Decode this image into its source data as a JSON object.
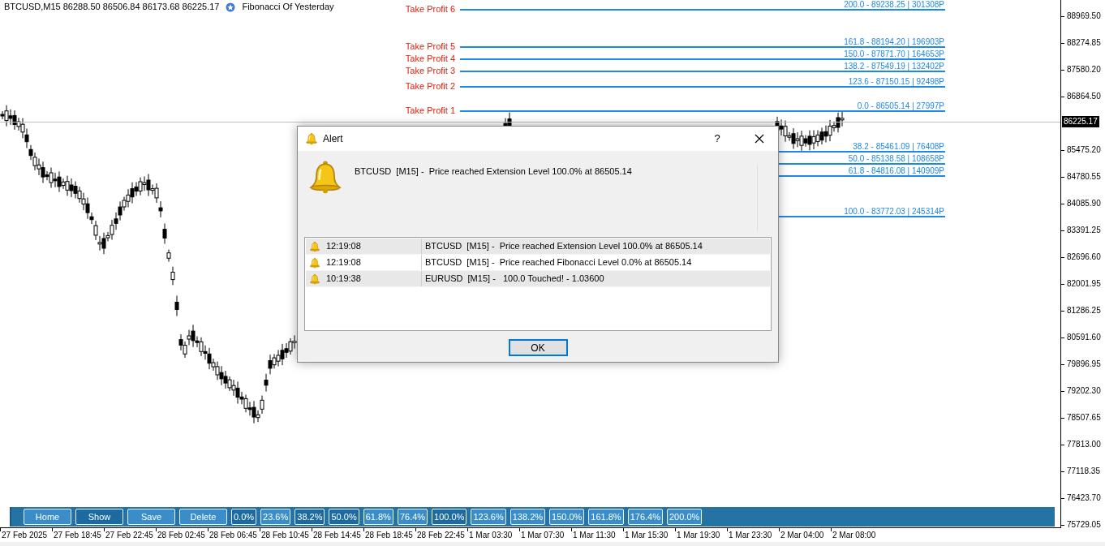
{
  "chart_header": {
    "symbol_info": "BTCUSD,M15  86288.50 86506.84 86173.68 86225.17",
    "indicator": "Fibonacci Of Yesterday"
  },
  "take_profit_labels": [
    "Take Profit 6",
    "Take Profit 5",
    "Take Profit 4",
    "Take Profit 3",
    "Take Profit 2",
    "Take Profit 1"
  ],
  "fib_levels": [
    {
      "label": "200.0 - 89238.25 | 301308P"
    },
    {
      "label": "161.8 - 88194.20 | 196903P"
    },
    {
      "label": "150.0 - 87871.70 | 164653P"
    },
    {
      "label": "138.2 - 87549.19 | 132402P"
    },
    {
      "label": "123.6 - 87150.15 | 92498P"
    },
    {
      "label": "0.0 - 86505.14 | 27997P"
    },
    {
      "label": "38.2 - 85461.09 | 76408P"
    },
    {
      "label": "50.0 - 85138.58 | 108658P"
    },
    {
      "label": "61.8 - 84816.08 | 140909P"
    },
    {
      "label": "100.0 - 83772.03 | 245314P"
    }
  ],
  "price_axis": {
    "labels": [
      {
        "text": "88969.50",
        "kind": "tick"
      },
      {
        "text": "88274.85",
        "kind": "tick"
      },
      {
        "text": "87580.20",
        "kind": "tick"
      },
      {
        "text": "86864.50",
        "kind": "tick"
      },
      {
        "text": "86225.17",
        "kind": "current"
      },
      {
        "text": "85475.20",
        "kind": "tick"
      },
      {
        "text": "84780.55",
        "kind": "tick"
      },
      {
        "text": "84085.90",
        "kind": "tick"
      },
      {
        "text": "83391.25",
        "kind": "tick"
      },
      {
        "text": "82696.60",
        "kind": "tick"
      },
      {
        "text": "82001.95",
        "kind": "tick"
      },
      {
        "text": "81286.25",
        "kind": "tick"
      },
      {
        "text": "80591.60",
        "kind": "tick"
      },
      {
        "text": "79896.95",
        "kind": "tick"
      },
      {
        "text": "79202.30",
        "kind": "tick"
      },
      {
        "text": "78507.65",
        "kind": "tick"
      },
      {
        "text": "77813.00",
        "kind": "tick"
      },
      {
        "text": "77118.35",
        "kind": "tick"
      },
      {
        "text": "76423.70",
        "kind": "tick"
      },
      {
        "text": "75729.05",
        "kind": "tick"
      }
    ]
  },
  "time_axis": [
    "27 Feb 2025",
    "27 Feb 18:45",
    "27 Feb 22:45",
    "28 Feb 02:45",
    "28 Feb 06:45",
    "28 Feb 10:45",
    "28 Feb 14:45",
    "28 Feb 18:45",
    "28 Feb 22:45",
    "1 Mar 03:30",
    "1 Mar 07:30",
    "1 Mar 11:30",
    "1 Mar 15:30",
    "1 Mar 19:30",
    "1 Mar 23:30",
    "2 Mar 04:00",
    "2 Mar 08:00"
  ],
  "toolbar": [
    {
      "label": "Home",
      "kind": "command",
      "on": false
    },
    {
      "label": "Show",
      "kind": "command",
      "on": true
    },
    {
      "label": "Save",
      "kind": "command",
      "on": false
    },
    {
      "label": "Delete",
      "kind": "command",
      "on": false
    },
    {
      "label": "0.0%",
      "kind": "level",
      "on": true
    },
    {
      "label": "23.6%",
      "kind": "level",
      "on": false
    },
    {
      "label": "38.2%",
      "kind": "level",
      "on": true
    },
    {
      "label": "50.0%",
      "kind": "level",
      "on": true
    },
    {
      "label": "61.8%",
      "kind": "level",
      "on": false
    },
    {
      "label": "76.4%",
      "kind": "level",
      "on": false
    },
    {
      "label": "100.0%",
      "kind": "level",
      "on": true
    },
    {
      "label": "123.6%",
      "kind": "level",
      "on": false
    },
    {
      "label": "138.2%",
      "kind": "level",
      "on": false
    },
    {
      "label": "150.0%",
      "kind": "level",
      "on": false
    },
    {
      "label": "161.8%",
      "kind": "level",
      "on": false
    },
    {
      "label": "176.4%",
      "kind": "level",
      "on": false
    },
    {
      "label": "200.0%",
      "kind": "level",
      "on": false
    }
  ],
  "alert_dialog": {
    "title": "Alert",
    "help": "?",
    "message": "BTCUSD  [M15] -  Price reached Extension Level 100.0% at 86505.14",
    "history": [
      {
        "time": "12:19:08",
        "text": "BTCUSD  [M15] -  Price reached Extension Level 100.0% at 86505.14"
      },
      {
        "time": "12:19:08",
        "text": "BTCUSD  [M15] -  Price reached Fibonacci Level 0.0% at 86505.14"
      },
      {
        "time": "10:19:38",
        "text": "EURUSD  [M15] -   100.0 Touched! - 1.03600"
      }
    ],
    "ok_button": "OK"
  }
}
